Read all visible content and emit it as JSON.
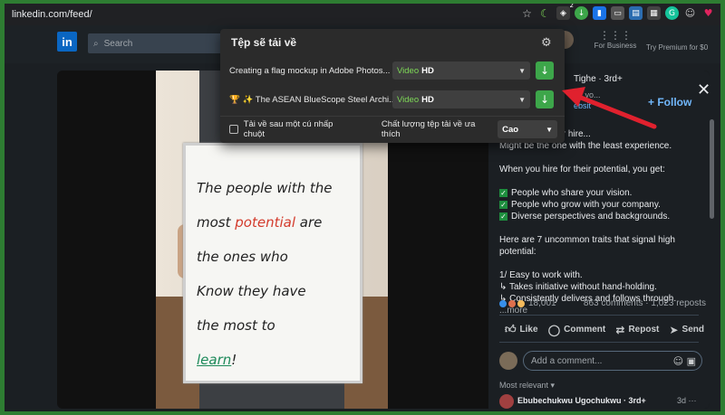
{
  "browser": {
    "url": "linkedin.com/feed/",
    "ext_badge": "2"
  },
  "nav": {
    "logo": "in",
    "search_placeholder": "Search",
    "business_label": "For Business",
    "premium_label": "Try Premium for $0"
  },
  "popup": {
    "title": "Tệp sẽ tải về",
    "rows": [
      {
        "name": "Creating a flag mockup in Adobe Photos...",
        "quality": "Video",
        "res": "HD"
      },
      {
        "name": "🏆 ✨ The ASEAN BlueScope Steel Archi...",
        "quality": "Video",
        "res": "HD"
      }
    ],
    "auto_download_label": "Tải về sau một cú nhấp chuột",
    "preferred_quality_label": "Chất lượng tệp tải về ưa thích",
    "preferred_quality_value": "Cao"
  },
  "board": {
    "line1": "The people with the",
    "line2a": "most ",
    "line2b": "potential",
    "line2c": " are",
    "line3": "the ones who",
    "line4": "Know they have",
    "line5": "the most to",
    "line6a": "learn",
    "line6b": "!"
  },
  "post": {
    "author_partial": "Tighe · 3rd+",
    "author_sub": "ng yo...",
    "author_link": "ebsit",
    "follow": "+ Follow",
    "close": "✕",
    "line0": "e you'll ever hire...",
    "line1": "Might be the one with the least experience.",
    "line2": "When you hire for their potential, you get:",
    "check1": "People who share your vision.",
    "check2": "People who grow with your company.",
    "check3": "Diverse perspectives and backgrounds.",
    "line3": "Here are 7 uncommon traits that signal high potential:",
    "line4": "1/ Easy to work with.",
    "line5": "↳ Takes initiative without hand-holding.",
    "line6": "↳ Consistently delivers and follows through.",
    "more": "...more",
    "reaction_count": "18,001",
    "comments_reposts": "863 comments · 1,023 reposts",
    "like": "Like",
    "comment": "Comment",
    "repost": "Repost",
    "send": "Send",
    "add_comment": "Add a comment...",
    "most_relevant": "Most relevant ▾",
    "commenter": "Ebubechukwu Ugochukwu · 3rd+",
    "commenter_time": "3d ···"
  }
}
